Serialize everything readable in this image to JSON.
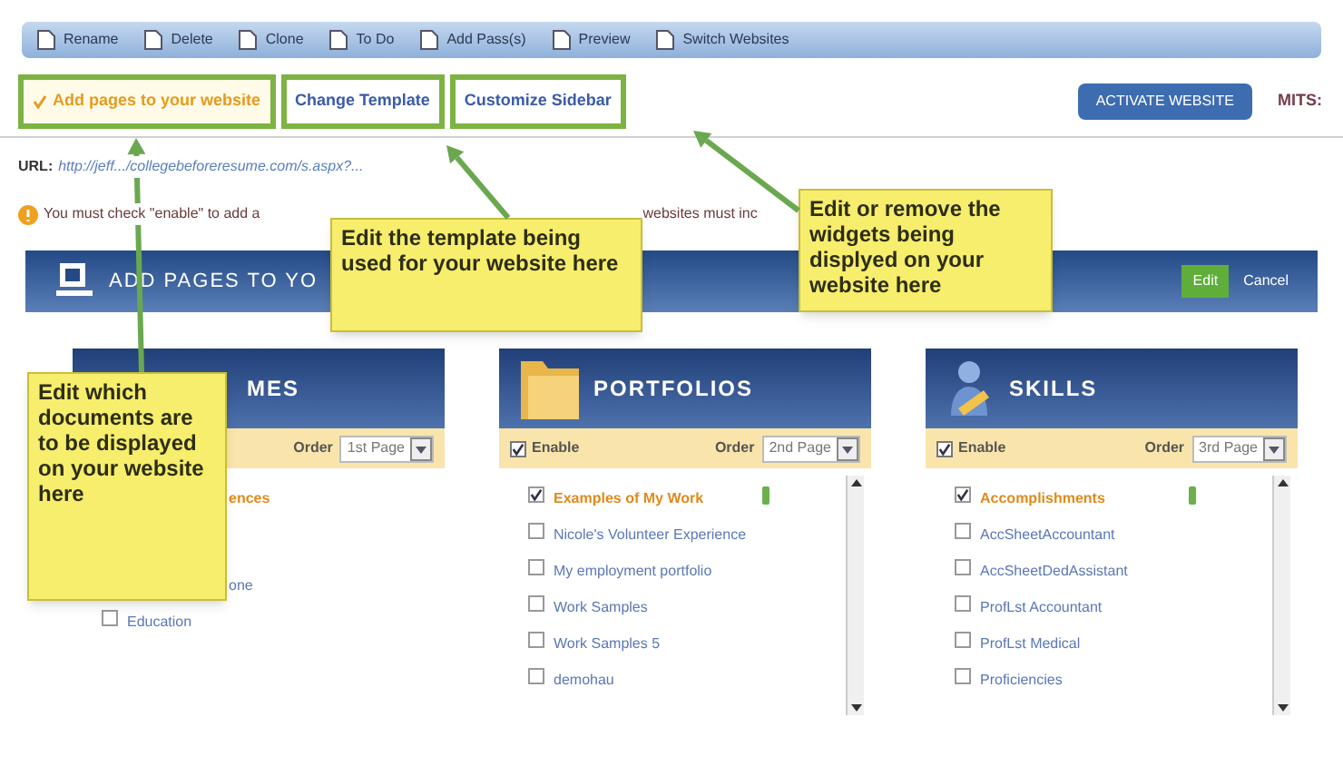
{
  "toolbar": [
    {
      "label": "Rename"
    },
    {
      "label": "Delete"
    },
    {
      "label": "Clone"
    },
    {
      "label": "To Do"
    },
    {
      "label": "Add Pass(s)"
    },
    {
      "label": "Preview"
    },
    {
      "label": "Switch Websites"
    }
  ],
  "tabs": [
    {
      "label": "Add pages to your website",
      "selected": true
    },
    {
      "label": "Change Template",
      "selected": false
    },
    {
      "label": "Customize Sidebar",
      "selected": false
    }
  ],
  "activate_button": "ACTIVATE WEBSITE",
  "column_right": "MITS:",
  "url": {
    "label": "URL:",
    "value": "http://jeff.../collegebeforeresume.com/s.aspx?..."
  },
  "warning": {
    "start": "You must check \"enable\" to add a",
    "end": "websites must inc"
  },
  "section": {
    "title": "ADD PAGES TO YO",
    "edit": "Edit",
    "cancel": "Cancel"
  },
  "panels": [
    {
      "kind": "resumes",
      "title": "MES",
      "order_label": "Order",
      "order_value": "1st Page",
      "items": [
        {
          "kind": "clipped",
          "text": "ences",
          "checked": true
        },
        {
          "kind": "clipped",
          "text": "one",
          "checked": false
        },
        {
          "kind": "check",
          "text": "Education",
          "checked": false
        }
      ]
    },
    {
      "kind": "folder",
      "title": "PORTFOLIOS",
      "enable": "Enable",
      "enabled": true,
      "order_label": "Order",
      "order_value": "2nd Page",
      "scroll": true,
      "items": [
        {
          "kind": "check",
          "text": "Examples of My Work",
          "checked": true
        },
        {
          "kind": "check",
          "text": "Nicole's Volunteer Experience",
          "checked": false
        },
        {
          "kind": "check",
          "text": "My employment portfolio",
          "checked": false
        },
        {
          "kind": "check",
          "text": "Work Samples",
          "checked": false
        },
        {
          "kind": "check",
          "text": "Work Samples 5",
          "checked": false
        },
        {
          "kind": "check",
          "text": "demohau",
          "checked": false
        }
      ]
    },
    {
      "kind": "person",
      "title": "SKILLS",
      "enable": "Enable",
      "enabled": true,
      "order_label": "Order",
      "order_value": "3rd Page",
      "scroll": true,
      "items": [
        {
          "kind": "check",
          "text": "Accomplishments",
          "checked": true
        },
        {
          "kind": "check",
          "text": "AccSheetAccountant",
          "checked": false
        },
        {
          "kind": "check",
          "text": "AccSheetDedAssistant",
          "checked": false
        },
        {
          "kind": "check",
          "text": "ProfLst Accountant",
          "checked": false
        },
        {
          "kind": "check",
          "text": "ProfLst Medical",
          "checked": false
        },
        {
          "kind": "check",
          "text": "Proficiencies",
          "checked": false
        }
      ]
    }
  ],
  "callouts": [
    {
      "text": "Edit which documents are to be displayed on your website here"
    },
    {
      "text": "Edit the template being used for your website here"
    },
    {
      "text": "Edit or remove the widgets being displyed on your website here"
    }
  ]
}
